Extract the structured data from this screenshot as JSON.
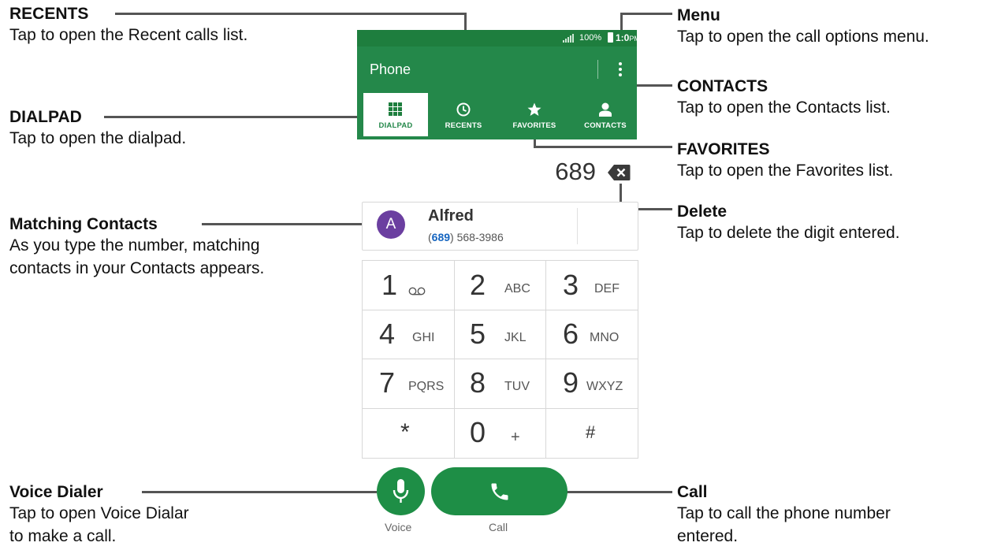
{
  "callouts": {
    "recents": {
      "title": "RECENTS",
      "desc": "Tap to open the Recent calls list."
    },
    "dialpad": {
      "title": "DIALPAD",
      "desc": "Tap to open the dialpad."
    },
    "matching": {
      "title": "Matching Contacts",
      "desc1": "As you type the number, matching",
      "desc2": "contacts in your Contacts appears."
    },
    "voice": {
      "title": "Voice Dialer",
      "desc1": "Tap to open Voice Dialar",
      "desc2": "to make a call."
    },
    "menu": {
      "title": "Menu",
      "desc": "Tap to open the call options menu."
    },
    "contacts": {
      "title": "CONTACTS",
      "desc": "Tap to open the Contacts list."
    },
    "favorites": {
      "title": "FAVORITES",
      "desc": "Tap to open the Favorites list."
    },
    "delete": {
      "title": "Delete",
      "desc": "Tap to delete the digit entered."
    },
    "call": {
      "title": "Call",
      "desc1": "Tap to call the phone number",
      "desc2": "entered."
    }
  },
  "status_bar": {
    "battery": "100%",
    "time": "1:0",
    "ampm": "PM"
  },
  "app_bar": {
    "title": "Phone"
  },
  "tabs": {
    "dialpad": "DIALPAD",
    "recents": "RECENTS",
    "favorites": "FAVORITES",
    "contacts": "CONTACTS"
  },
  "dialed_number": "689",
  "matching_contact": {
    "initial": "A",
    "name": "Alfred",
    "number_prefix": "(",
    "number_match": "689",
    "number_rest": ") 568-3986"
  },
  "keys": [
    {
      "digit": "1",
      "letters": ""
    },
    {
      "digit": "2",
      "letters": "ABC"
    },
    {
      "digit": "3",
      "letters": "DEF"
    },
    {
      "digit": "4",
      "letters": "GHI"
    },
    {
      "digit": "5",
      "letters": "JKL"
    },
    {
      "digit": "6",
      "letters": "MNO"
    },
    {
      "digit": "7",
      "letters": "PQRS"
    },
    {
      "digit": "8",
      "letters": "TUV"
    },
    {
      "digit": "9",
      "letters": "WXYZ"
    },
    {
      "digit": "*",
      "letters": ""
    },
    {
      "digit": "0",
      "letters": "+"
    },
    {
      "digit": "#",
      "letters": ""
    }
  ],
  "buttons": {
    "voice": "Voice",
    "call": "Call"
  },
  "colors": {
    "primary": "#24884a",
    "status": "#1e7e3e",
    "button": "#1e8e46",
    "avatar": "#6b3fa0",
    "match": "#1565c0"
  }
}
